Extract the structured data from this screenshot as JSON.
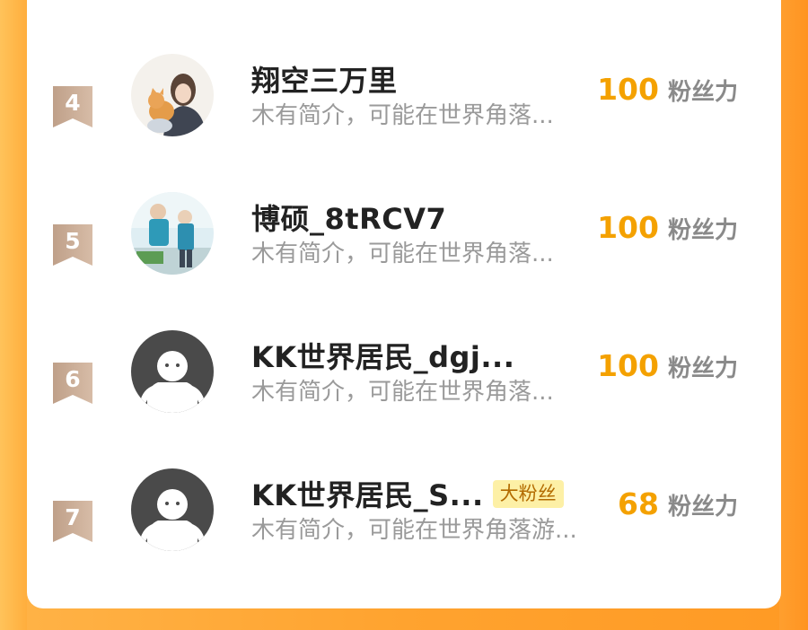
{
  "rows": [
    {
      "rank": "4",
      "name": "翔空三万里",
      "tag": "",
      "desc": "木有简介，可能在世界角落...",
      "score": "100",
      "unit": "粉丝力",
      "avatar": "illustrated-person-cat-avatar"
    },
    {
      "rank": "5",
      "name": "博硕_8tRCV7",
      "tag": "",
      "desc": "木有简介，可能在世界角落...",
      "score": "100",
      "unit": "粉丝力",
      "avatar": "photo-avatar"
    },
    {
      "rank": "6",
      "name": "KK世界居民_dgj...",
      "tag": "",
      "desc": "木有简介，可能在世界角落...",
      "score": "100",
      "unit": "粉丝力",
      "avatar": "default-avatar"
    },
    {
      "rank": "7",
      "name": "KK世界居民_S...",
      "tag": "大粉丝",
      "desc": "木有简介，可能在世界角落游...",
      "score": "68",
      "unit": "粉丝力",
      "avatar": "default-avatar"
    }
  ],
  "colors": {
    "accent_score": "#f4a100",
    "background": "#ffa32f",
    "badge": "#c8a88e",
    "tag_bg": "#fdf0a6"
  }
}
